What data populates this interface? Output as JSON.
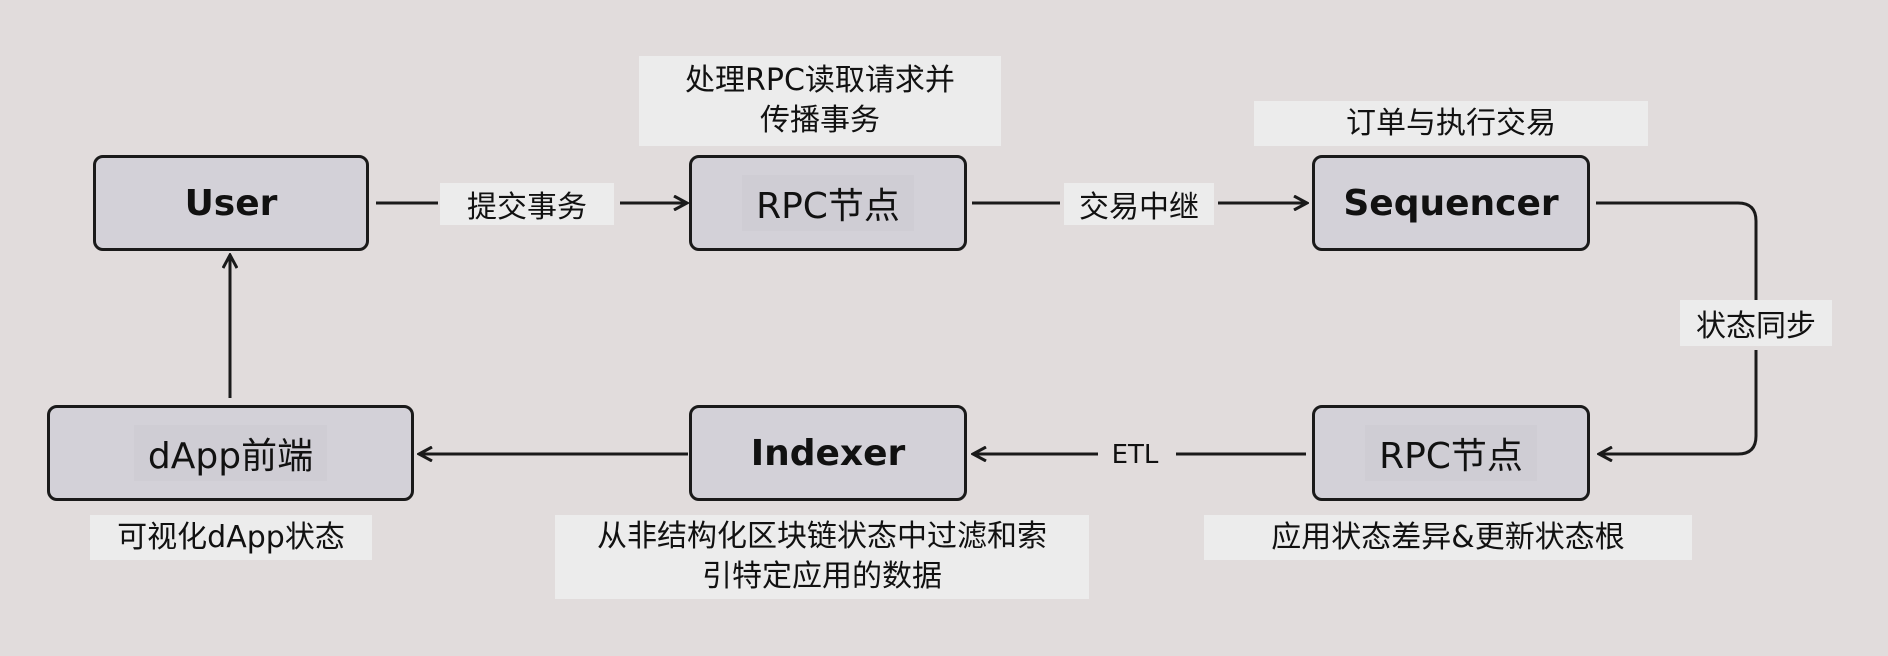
{
  "nodes": {
    "user": "User",
    "rpc_top": "RPC节点",
    "sequencer": "Sequencer",
    "dapp": "dApp前端",
    "indexer": "Indexer",
    "rpc_bottom": "RPC节点"
  },
  "edges": {
    "submit_tx": "提交事务",
    "tx_relay": "交易中继",
    "state_sync": "状态同步",
    "etl": "ETL"
  },
  "annotations": {
    "rpc_top_line1": "处理RPC读取请求并",
    "rpc_top_line2": "传播事务",
    "sequencer": "订单与执行交易",
    "dapp": "可视化dApp状态",
    "indexer_line1": "从非结构化区块链状态中过滤和索",
    "indexer_line2": "引特定应用的数据",
    "rpc_bottom": "应用状态差异&更新状态根"
  }
}
